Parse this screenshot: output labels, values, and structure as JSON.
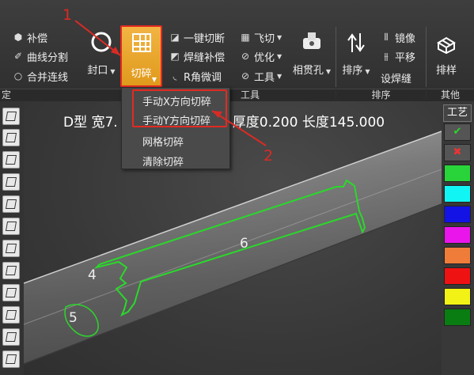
{
  "ribbon": {
    "group1": {
      "items": [
        {
          "icon": "compensation-icon",
          "label": "补偿"
        },
        {
          "icon": "curve-split-icon",
          "label": "曲线分割"
        },
        {
          "icon": "merge-line-icon",
          "label": "合并连线"
        }
      ],
      "group_label": "定"
    },
    "seal": {
      "label": "封口"
    },
    "chop": {
      "label": "切碎"
    },
    "group3": {
      "items": [
        {
          "icon": "one-key-cut-icon",
          "label": "一键切断"
        },
        {
          "icon": "weld-comp-icon",
          "label": "焊缝补偿"
        },
        {
          "icon": "r-corner-icon",
          "label": "R角微调"
        }
      ]
    },
    "group4": {
      "items": [
        {
          "icon": "fly-cut-icon",
          "label": "飞切"
        },
        {
          "icon": "optimize-icon",
          "label": "优化"
        },
        {
          "icon": "tool-icon",
          "label": "工具"
        }
      ]
    },
    "intersect": {
      "label": "相贯孔"
    },
    "tools_group_label": "工具",
    "sort": {
      "label": "排序"
    },
    "group5": {
      "items": [
        {
          "icon": "mirror-icon",
          "label": "镜像"
        },
        {
          "icon": "translate-icon",
          "label": "平移"
        },
        {
          "label": "设焊缝"
        }
      ],
      "group_label": "排序"
    },
    "layout": {
      "label": "排样"
    },
    "other_group_label": "其他"
  },
  "menu": {
    "items": [
      "手动X方向切碎",
      "手动Y方向切碎",
      "网格切碎",
      "清除切碎"
    ]
  },
  "viewport": {
    "info": "D型 宽7.",
    "info_rest": "00 厚度0.200 长度145.000",
    "part_labels": [
      "4",
      "5",
      "6"
    ]
  },
  "right_palette": {
    "title": "工艺",
    "colors": [
      "#29d33a",
      "#12f5f5",
      "#1313e6",
      "#ea15ea",
      "#f07c3a",
      "#ef1212",
      "#f2f216",
      "#0a7d12"
    ]
  },
  "callouts": [
    "1",
    "2"
  ]
}
